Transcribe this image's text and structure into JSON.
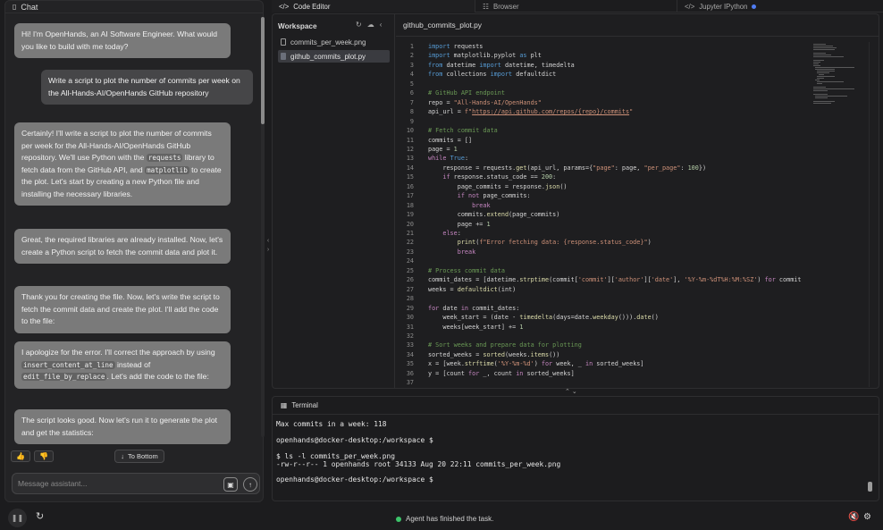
{
  "chat": {
    "title": "Chat",
    "messages": [
      {
        "role": "assistant",
        "text": "Hi! I'm OpenHands, an AI Software Engineer. What would you like to build with me today?"
      },
      {
        "role": "user",
        "text": "Write a script to plot the number of commits per week on the All-Hands-AI/OpenHands GitHub repository"
      },
      {
        "role": "assistant",
        "parts": [
          "Certainly! I'll write a script to plot the number of commits per week for the All-Hands-AI/OpenHands GitHub repository. We'll use Python with the ",
          "requests",
          " library to fetch data from the GitHub API, and ",
          "matplotlib",
          " to create the plot. Let's start by creating a new Python file and installing the necessary libraries."
        ]
      },
      {
        "role": "assistant",
        "text": "Great, the required libraries are already installed. Now, let's create a Python script to fetch the commit data and plot it."
      },
      {
        "role": "assistant",
        "text": "Thank you for creating the file. Now, let's write the script to fetch the commit data and create the plot. I'll add the code to the file:"
      },
      {
        "role": "assistant",
        "parts": [
          "I apologize for the error. I'll correct the approach by using ",
          "insert_content_at_line",
          " instead of ",
          "edit_file_by_replace",
          ". Let's add the code to the file:"
        ]
      },
      {
        "role": "assistant",
        "text": "The script looks good. Now let's run it to generate the plot and get the statistics:"
      }
    ],
    "to_bottom": "To Bottom",
    "input_placeholder": "Message assistant..."
  },
  "tabs": [
    {
      "label": "Code Editor",
      "icon": "code-icon",
      "active": true
    },
    {
      "label": "Browser",
      "icon": "globe-icon",
      "active": false
    },
    {
      "label": "Jupyter IPython",
      "icon": "angle-brackets-icon",
      "active": false
    }
  ],
  "workspace": {
    "title": "Workspace",
    "files": [
      {
        "name": "commits_per_week.png",
        "selected": false
      },
      {
        "name": "github_commits_plot.py",
        "selected": true
      }
    ]
  },
  "editor": {
    "file_tab": "github_commits_plot.py",
    "lines": [
      "import requests",
      "import matplotlib.pyplot as plt",
      "from datetime import datetime, timedelta",
      "from collections import defaultdict",
      "",
      "# GitHub API endpoint",
      "repo = \"All-Hands-AI/OpenHands\"",
      "api_url = f\"https://api.github.com/repos/{repo}/commits\"",
      "",
      "# Fetch commit data",
      "commits = []",
      "page = 1",
      "while True:",
      "    response = requests.get(api_url, params={\"page\": page, \"per_page\": 100})",
      "    if response.status_code == 200:",
      "        page_commits = response.json()",
      "        if not page_commits:",
      "            break",
      "        commits.extend(page_commits)",
      "        page += 1",
      "    else:",
      "        print(f\"Error fetching data: {response.status_code}\")",
      "        break",
      "",
      "# Process commit data",
      "commit_dates = [datetime.strptime(commit['commit']['author']['date'], '%Y-%m-%dT%H:%M:%SZ') for commit",
      "weeks = defaultdict(int)",
      "",
      "for date in commit_dates:",
      "    week_start = (date - timedelta(days=date.weekday())).date()",
      "    weeks[week_start] += 1",
      "",
      "# Sort weeks and prepare data for plotting",
      "sorted_weeks = sorted(weeks.items())",
      "x = [week.strftime('%Y-%m-%d') for week, _ in sorted_weeks]",
      "y = [count for _, count in sorted_weeks]",
      ""
    ]
  },
  "terminal": {
    "title": "Terminal",
    "lines": [
      "Max commits in a week: 118",
      "",
      "openhands@docker-desktop:/workspace $",
      "",
      "$ ls -l commits_per_week.png",
      "-rw-r--r-- 1 openhands root 34133 Aug 20 22:11 commits_per_week.png",
      "",
      "openhands@docker-desktop:/workspace $"
    ]
  },
  "status": {
    "text": "Agent has finished the task.",
    "color": "#3cc46a"
  }
}
